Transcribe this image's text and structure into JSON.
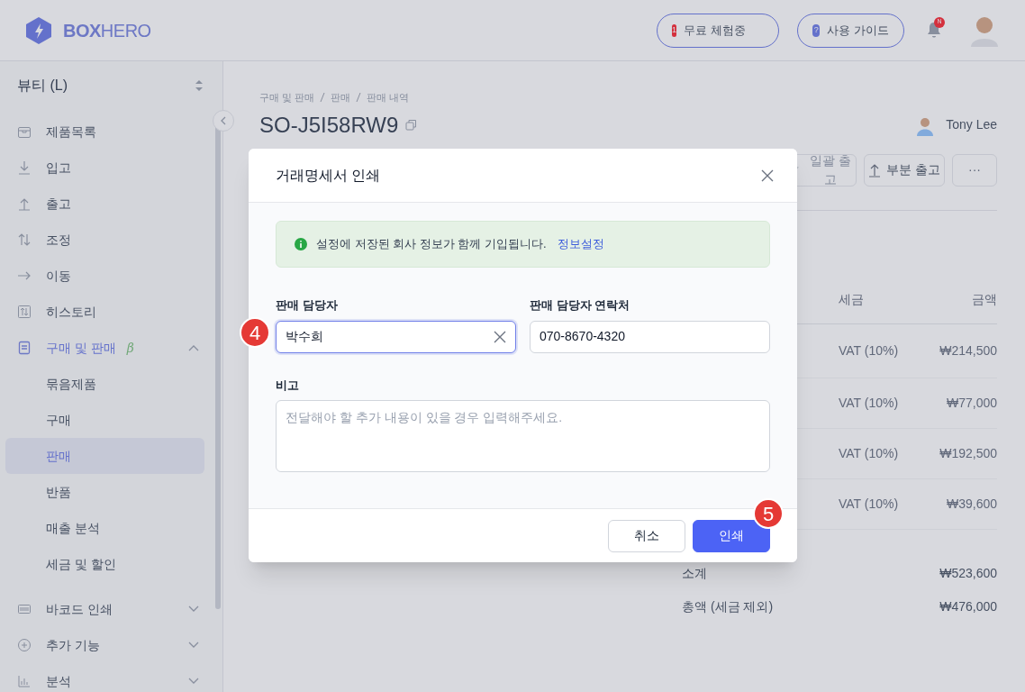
{
  "header": {
    "logo": "**BOX**HERO",
    "trial_button": {
      "badge": "1",
      "label": "무료 체험중"
    },
    "guide_button": {
      "badge": "?",
      "label": "사용 가이드"
    },
    "notification_badge": "N"
  },
  "sidebar": {
    "workspace": "뷰티 (L)",
    "items": [
      {
        "label": "제품목록",
        "selected": false
      },
      {
        "label": "입고",
        "selected": false
      },
      {
        "label": "출고",
        "selected": false
      },
      {
        "label": "조정",
        "selected": false
      },
      {
        "label": "이동",
        "selected": false
      },
      {
        "label": "히스토리",
        "selected": false
      },
      {
        "label": "구매 및 판매",
        "badge": "β",
        "selected": true,
        "expanded": true,
        "children": [
          {
            "label": "묶음제품",
            "selected": false
          },
          {
            "label": "구매",
            "selected": false
          },
          {
            "label": "판매",
            "selected": true
          },
          {
            "label": "반품",
            "selected": false
          },
          {
            "label": "매출 분석",
            "selected": false
          },
          {
            "label": "세금 및 할인",
            "selected": false
          }
        ]
      },
      {
        "label": "바코드 인쇄",
        "selected": false,
        "expanded": false
      },
      {
        "label": "추가 기능",
        "selected": false,
        "expanded": false
      },
      {
        "label": "분석",
        "selected": false,
        "expanded": false
      }
    ]
  },
  "page": {
    "breadcrumb": [
      "구매 및 판매",
      "판매",
      "판매 내역"
    ],
    "title": "SO-J5I58RW9",
    "owner": "Tony Lee",
    "actions": [
      "일괄 출고",
      "부분 출고",
      "···"
    ],
    "table": {
      "columns": [
        "세금",
        "금액"
      ],
      "rows": [
        [
          "VAT (10%)",
          "₩214,500"
        ],
        [
          "VAT (10%)",
          "₩77,000"
        ],
        [
          "VAT (10%)",
          "₩192,500"
        ],
        [
          "VAT (10%)",
          "₩39,600"
        ]
      ]
    },
    "totals": [
      {
        "label": "소계",
        "value": "₩523,600"
      },
      {
        "label": "총액 (세금 제외)",
        "value": "₩476,000"
      }
    ]
  },
  "modal": {
    "title": "거래명세서 인쇄",
    "notice": {
      "text": "설정에 저장된 회사 정보가 함께 기입됩니다.",
      "link": "정보설정"
    },
    "fields": [
      {
        "label": "판매 담당자",
        "value": "박수희",
        "focused": true
      },
      {
        "label": "판매 담당자 연락처",
        "value": "070-8670-4320",
        "focused": false
      }
    ],
    "memo": {
      "label": "비고",
      "placeholder": "전달해야 할 추가 내용이 있을 경우 입력해주세요."
    },
    "buttons": [
      {
        "label": "취소",
        "kind": "secondary"
      },
      {
        "label": "인쇄",
        "kind": "primary"
      }
    ]
  },
  "annotations": [
    "4",
    "5"
  ]
}
